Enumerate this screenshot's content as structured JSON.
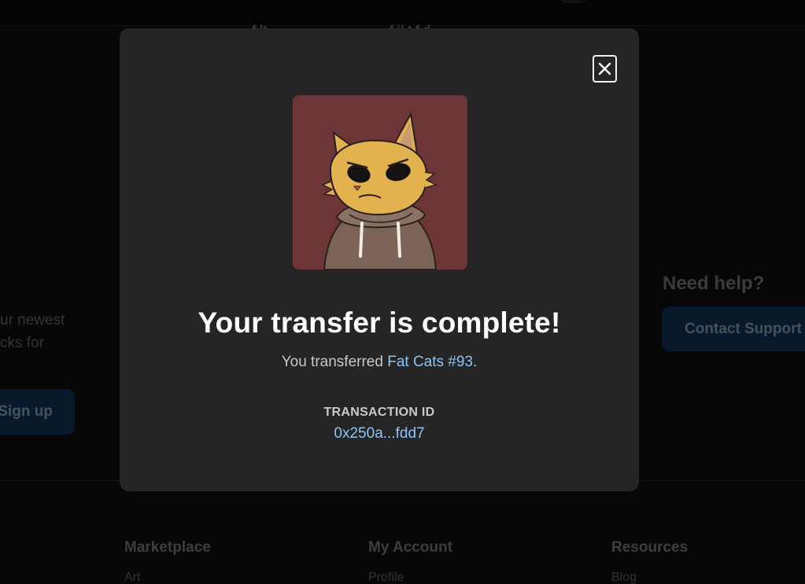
{
  "background": {
    "header_cut_texts": [
      "f lt",
      "f il t f d"
    ],
    "newsletter_lines": [
      "ur newest",
      "cks for"
    ],
    "signup_label": "Sign up",
    "help": {
      "title": "Need help?",
      "contact_label": "Contact Support"
    },
    "footer": {
      "columns": [
        {
          "title": "Marketplace",
          "first_link": "Art"
        },
        {
          "title": "My Account",
          "first_link": "Profile"
        },
        {
          "title": "Resources",
          "first_link": "Blog"
        }
      ]
    }
  },
  "modal": {
    "title": "Your transfer is complete!",
    "subtitle_prefix": "You transferred ",
    "nft_name": "Fat Cats #93",
    "subtitle_suffix": ".",
    "transaction_label": "TRANSACTION ID",
    "transaction_id": "0x250a...fdd7",
    "close_icon": "close-icon",
    "image_icon": "fat-cat-nft-image"
  },
  "colors": {
    "modal_bg": "#252525",
    "accent_link": "#8cc4f7",
    "image_bg": "#6e3538",
    "button_bg": "#0c2742"
  }
}
